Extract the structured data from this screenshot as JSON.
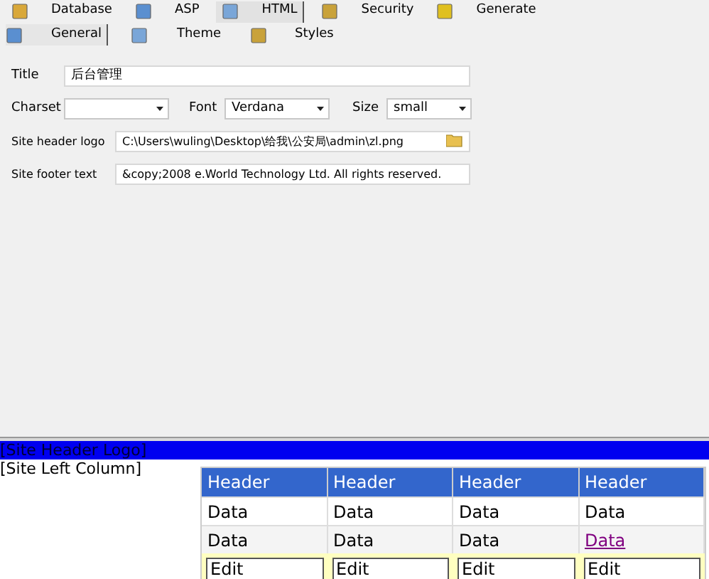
{
  "tabs": [
    {
      "label": "Database",
      "selected": false
    },
    {
      "label": "ASP",
      "selected": false
    },
    {
      "label": "HTML",
      "selected": true
    },
    {
      "label": "Security",
      "selected": false
    },
    {
      "label": "Generate",
      "selected": false
    }
  ],
  "subtabs": [
    {
      "label": "General",
      "selected": true
    },
    {
      "label": "Theme",
      "selected": false
    },
    {
      "label": "Styles",
      "selected": false
    }
  ],
  "form": {
    "title": {
      "label": "Title",
      "value": "后台管理"
    },
    "charset": {
      "label": "Charset"
    },
    "font": {
      "label": "Font",
      "value": "Verdana"
    },
    "size": {
      "label": "Size",
      "value": "small"
    },
    "header_logo": {
      "label": "Site header logo",
      "value": "C:\\Users\\wuling\\Desktop\\给我\\公安局\\admin\\zl.png"
    },
    "footer_text": {
      "label": "Site footer text",
      "value": "&copy;2008 e.World Technology Ltd. All rights reserved."
    }
  },
  "preview": {
    "header": "[Site Header Logo]",
    "left_column": "[Site Left Column]",
    "table": {
      "columns": [
        "Header",
        "Header",
        "Header",
        "Header"
      ],
      "rows": [
        [
          {
            "text": "Data",
            "kind": "text"
          },
          {
            "text": "Data",
            "kind": "text"
          },
          {
            "text": "Data",
            "kind": "text"
          },
          {
            "text": "Data",
            "kind": "text"
          }
        ],
        [
          {
            "text": "Data",
            "kind": "text"
          },
          {
            "text": "Data",
            "kind": "text"
          },
          {
            "text": "Data",
            "kind": "text"
          },
          {
            "text": "Data",
            "kind": "link"
          }
        ]
      ],
      "edit_row": [
        "Edit",
        "Edit",
        "Edit",
        "Edit"
      ]
    }
  }
}
